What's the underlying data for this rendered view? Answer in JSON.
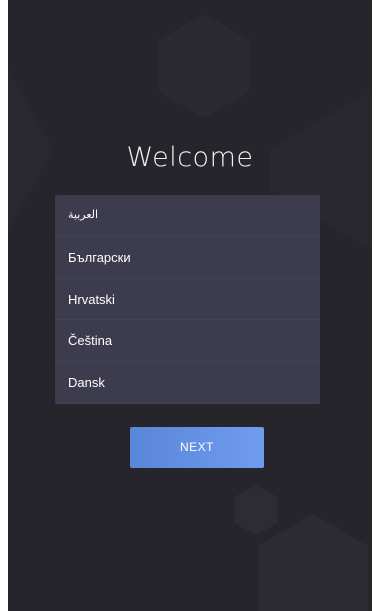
{
  "welcome": {
    "title": "Welcome"
  },
  "languages": [
    {
      "label": "العربية"
    },
    {
      "label": "Български"
    },
    {
      "label": "Hrvatski"
    },
    {
      "label": "Čeština"
    },
    {
      "label": "Dansk"
    }
  ],
  "actions": {
    "next_label": "NEXT"
  },
  "colors": {
    "background": "#26252c",
    "list_background": "#3d3c4e",
    "accent": "#6a95e8",
    "text": "#ffffff"
  }
}
